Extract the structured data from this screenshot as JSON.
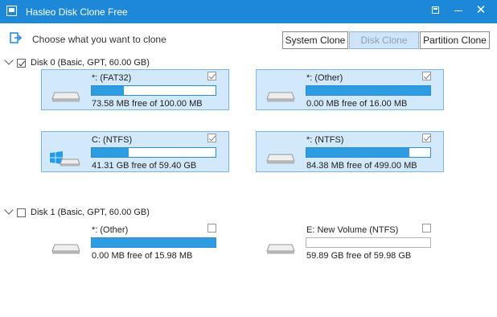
{
  "window": {
    "title": "Hasleo Disk Clone Free"
  },
  "toolbar": {
    "prompt": "Choose what you want to clone",
    "tabs": [
      "System Clone",
      "Disk Clone",
      "Partition Clone"
    ],
    "selected_tab": "Disk Clone"
  },
  "colors": {
    "titlebar": "#1e88d8",
    "selection": "#d2e8fb",
    "bar_fill": "#2e9ce0"
  },
  "disks": [
    {
      "label": "Disk 0 (Basic, GPT, 60.00 GB)",
      "checked": true,
      "partitions": [
        {
          "name": "*: (FAT32)",
          "free": "73.58 MB free of 100.00 MB",
          "used_fraction": 0.26,
          "checked": true,
          "selected": true,
          "icon": "drive-icon"
        },
        {
          "name": "*: (Other)",
          "free": "0.00 MB free of 16.00 MB",
          "used_fraction": 1.0,
          "checked": true,
          "selected": true,
          "icon": "drive-icon"
        },
        {
          "name": "C: (NTFS)",
          "free": "41.31 GB free of 59.40 GB",
          "used_fraction": 0.3,
          "checked": true,
          "selected": true,
          "icon": "windows-drive-icon"
        },
        {
          "name": "*: (NTFS)",
          "free": "84.38 MB free of 499.00 MB",
          "used_fraction": 0.83,
          "checked": true,
          "selected": true,
          "icon": "drive-icon"
        }
      ]
    },
    {
      "label": "Disk 1 (Basic, GPT, 60.00 GB)",
      "checked": false,
      "partitions": [
        {
          "name": "*: (Other)",
          "free": "0.00 MB free of 15.98 MB",
          "used_fraction": 1.0,
          "checked": false,
          "selected": false,
          "icon": "drive-icon"
        },
        {
          "name": "E: New Volume (NTFS)",
          "free": "59.89 GB free of 59.98 GB",
          "used_fraction": 0.0,
          "checked": false,
          "selected": false,
          "icon": "drive-icon"
        }
      ]
    }
  ]
}
